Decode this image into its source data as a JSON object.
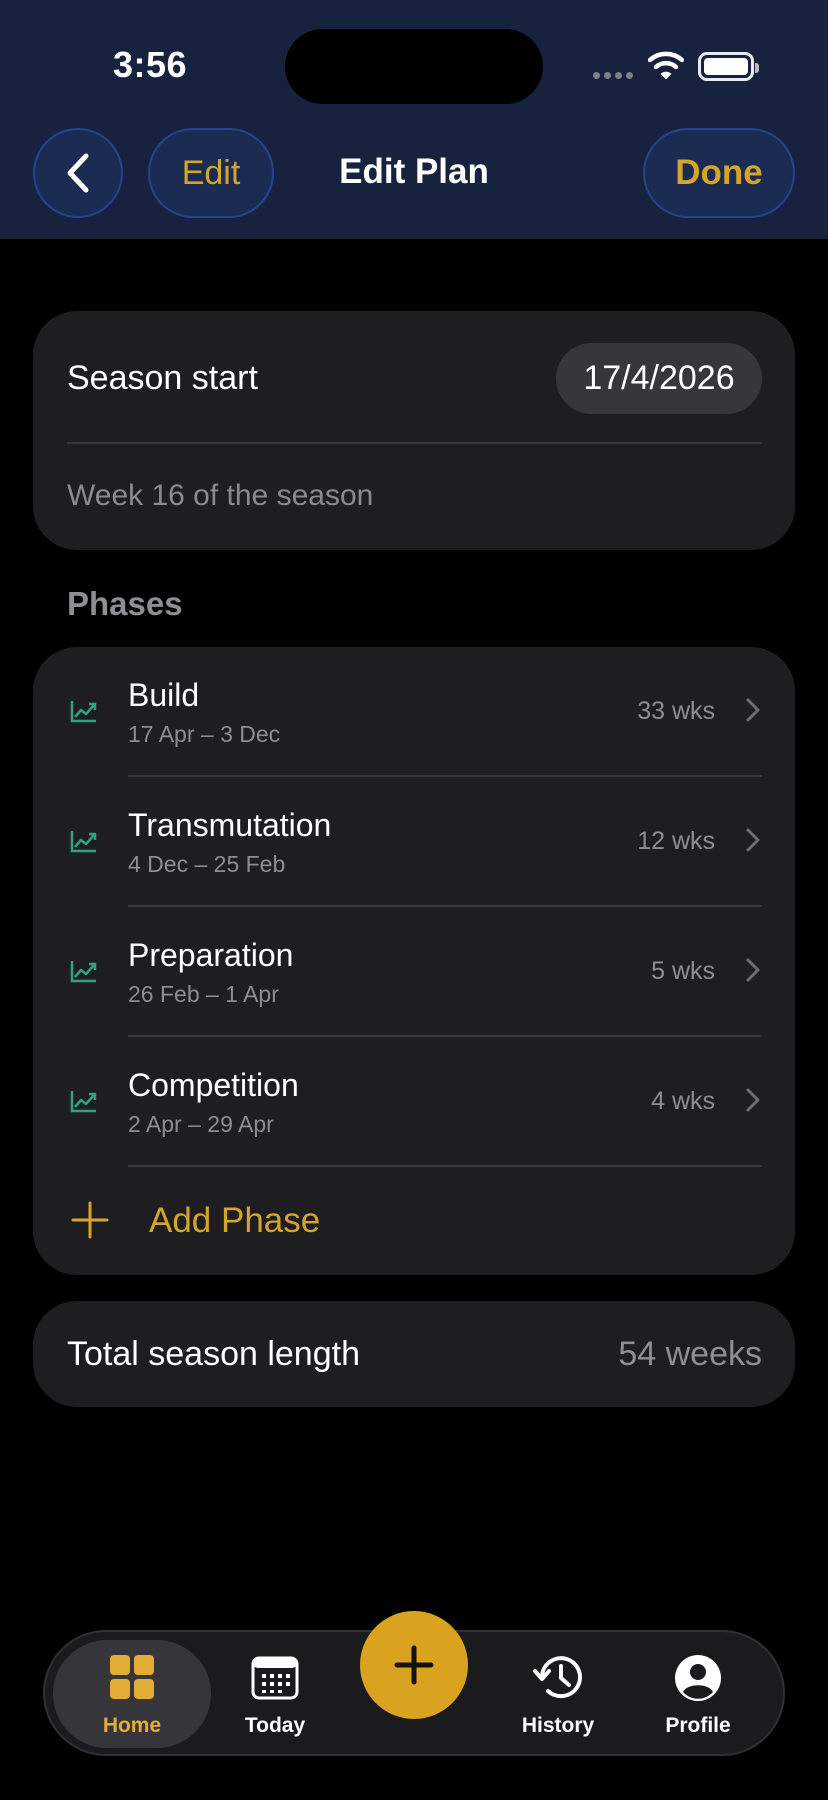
{
  "status_bar": {
    "time": "3:56"
  },
  "nav": {
    "edit_label": "Edit",
    "title": "Edit Plan",
    "done_label": "Done"
  },
  "season": {
    "start_label": "Season start",
    "start_date": "17/4/2026",
    "week_text": "Week 16 of the season"
  },
  "phases": {
    "section_title": "Phases",
    "items": [
      {
        "name": "Build",
        "dates": "17 Apr – 3 Dec",
        "weeks": "33 wks"
      },
      {
        "name": "Transmutation",
        "dates": "4 Dec – 25 Feb",
        "weeks": "12 wks"
      },
      {
        "name": "Preparation",
        "dates": "26 Feb – 1 Apr",
        "weeks": "5 wks"
      },
      {
        "name": "Competition",
        "dates": "2 Apr – 29 Apr",
        "weeks": "4 wks"
      }
    ],
    "add_label": "Add Phase"
  },
  "total": {
    "label": "Total season length",
    "value": "54 weeks"
  },
  "tabbar": {
    "home": "Home",
    "today": "Today",
    "history": "History",
    "profile": "Profile"
  },
  "colors": {
    "accent": "#d4a52a",
    "header_bg": "#17223f",
    "card_bg": "#1e1e21",
    "phase_icon": "#2fa37c"
  },
  "icons": {
    "back": "chevron-left-icon",
    "phase": "trend-up-icon",
    "row": "chevron-right-icon",
    "add": "plus-icon",
    "home": "grid-icon",
    "today": "calendar-icon",
    "fab": "plus-icon",
    "history": "history-icon",
    "profile": "person-icon"
  }
}
